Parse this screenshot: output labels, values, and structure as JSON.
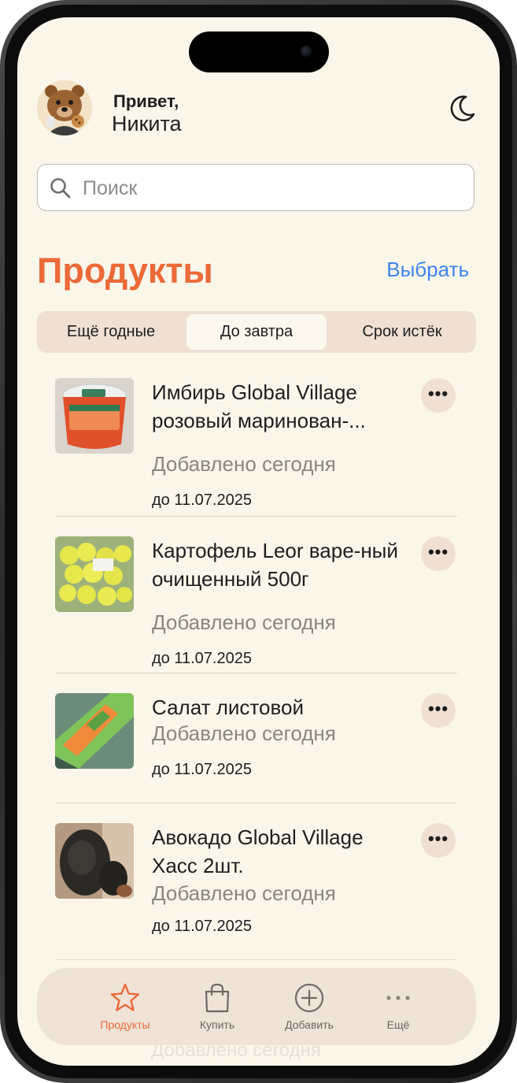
{
  "header": {
    "greeting": "Привет,",
    "user_name": "Никита"
  },
  "search": {
    "placeholder": "Поиск"
  },
  "section": {
    "title": "Продукты",
    "select_label": "Выбрать"
  },
  "segments": [
    {
      "label": "Ещё годные",
      "active": false
    },
    {
      "label": "До завтра",
      "active": true
    },
    {
      "label": "Срок истёк",
      "active": false
    }
  ],
  "products": [
    {
      "name": "Имбирь Global Village розовый маринован-...",
      "added": "Добавлено сегодня",
      "expires": "до 11.07.2025",
      "image": "ginger-jar"
    },
    {
      "name": "Картофель Leor варе-ный очищенный 500г",
      "added": "Добавлено сегодня",
      "expires": "до 11.07.2025",
      "image": "potato-bag"
    },
    {
      "name": "Салат листовой",
      "added": "Добавлено сегодня",
      "expires": "до 11.07.2025",
      "image": "lettuce-pack"
    },
    {
      "name": "Авокадо Global Village Хасс 2шт.",
      "added": "Добавлено сегодня",
      "expires": "до 11.07.2025",
      "image": "avocado"
    }
  ],
  "more_button_label": "•••",
  "peek_text": "Добавлено сегодня",
  "tabbar": [
    {
      "label": "Продукты",
      "icon": "star-icon",
      "active": true
    },
    {
      "label": "Купить",
      "icon": "bag-icon",
      "active": false
    },
    {
      "label": "Добавить",
      "icon": "plus-circle-icon",
      "active": false
    },
    {
      "label": "Ещё",
      "icon": "ellipsis-icon",
      "active": false
    }
  ],
  "colors": {
    "accent": "#ec6a38",
    "link": "#3d84ee",
    "background": "#fbf6ea",
    "chip": "#efe0d3"
  }
}
